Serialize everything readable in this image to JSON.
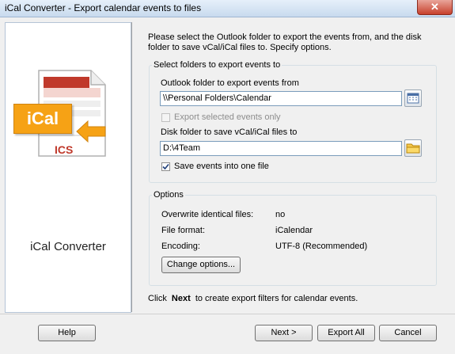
{
  "window": {
    "title": "iCal Converter - Export calendar events to files",
    "close_glyph": "✕"
  },
  "left_panel": {
    "app_name": "iCal Converter",
    "logo_label": "iCal",
    "file_ext": "ICS",
    "logo_color": "#f6a215",
    "ext_color": "#c0392b"
  },
  "intro": "Please select the Outlook folder to export the events from, and the disk folder to save vCal/iCal files to. Specify options.",
  "folders_group": {
    "title": "Select folders to export events to",
    "outlook_label": "Outlook folder to export events from",
    "outlook_value": "\\\\Personal Folders\\Calendar",
    "outlook_icon": "calendar-icon",
    "selected_only_label": "Export selected events only",
    "selected_only_checked": false,
    "disk_label": "Disk folder to save vCal/iCal files to",
    "disk_value": "D:\\4Team",
    "disk_icon": "folder-icon",
    "one_file_label": "Save events into one file",
    "one_file_checked": true
  },
  "options_group": {
    "title": "Options",
    "rows": [
      {
        "label": "Overwrite identical files:",
        "value": "no"
      },
      {
        "label": "File format:",
        "value": "iCalendar"
      },
      {
        "label": "Encoding:",
        "value": "UTF-8 (Recommended)"
      }
    ],
    "change_button": "Change options..."
  },
  "footer_hint": {
    "prefix": "Click",
    "bold": "Next",
    "suffix": "to create export filters for calendar events."
  },
  "buttons": {
    "help": "Help",
    "next": "Next >",
    "export_all": "Export All",
    "cancel": "Cancel"
  }
}
